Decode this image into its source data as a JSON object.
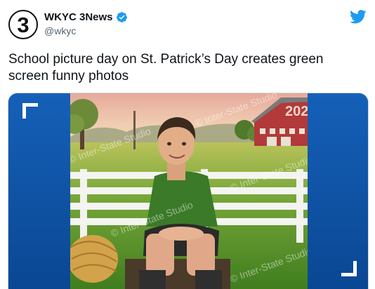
{
  "account": {
    "avatar_text": "3",
    "display_name": "WKYC 3News",
    "handle": "@wkyc",
    "verified_icon": "verified-badge-icon",
    "platform_icon": "twitter-bird-icon"
  },
  "tweet": {
    "text": "School picture day on St. Patrick’s Day creates green screen funny photos"
  },
  "media": {
    "watermark": "© Inter-State Studio",
    "barn_sign": "202",
    "colors": {
      "frame_blue": "#0e53a5",
      "sky": "#e8b7a6",
      "grass": "#5f9c2a",
      "barn": "#b23a3a",
      "accent_blue": "#1d9bf0"
    }
  }
}
